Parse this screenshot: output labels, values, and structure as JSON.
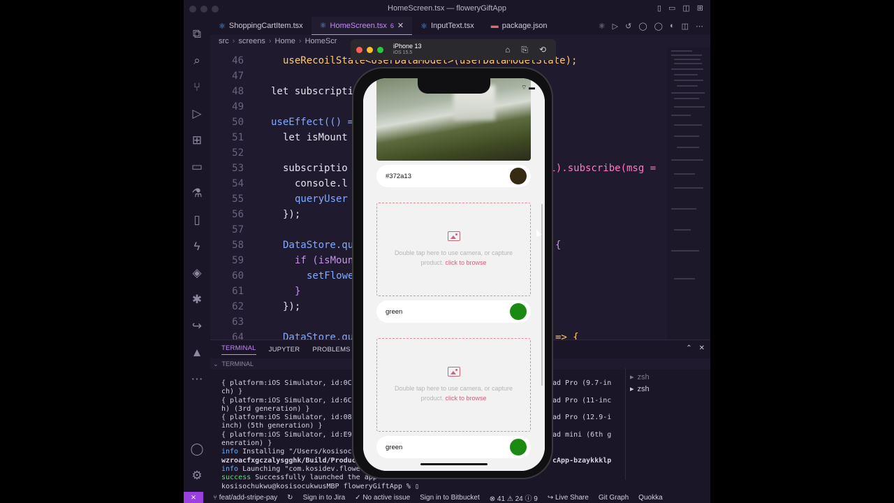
{
  "window": {
    "title": "HomeScreen.tsx — floweryGiftApp"
  },
  "tabs": [
    {
      "label": "ShoppingCartItem.tsx"
    },
    {
      "label": "HomeScreen.tsx",
      "badge": "6"
    },
    {
      "label": "InputText.tsx"
    },
    {
      "label": "package.json"
    }
  ],
  "breadcrumb": [
    "src",
    "screens",
    "Home",
    "HomeScr"
  ],
  "editor": {
    "lines": [
      {
        "n": "46",
        "code": "useRecoilState<UserDataModel>(userDataModelState);"
      },
      {
        "n": "47",
        "code": ""
      },
      {
        "n": "48",
        "code": "let subscripti"
      },
      {
        "n": "49",
        "code": ""
      },
      {
        "n": "50",
        "code": "useEffect(() ="
      },
      {
        "n": "51",
        "code": "let isMount"
      },
      {
        "n": "52",
        "code": ""
      },
      {
        "n": "53",
        "code": "subscriptio"
      },
      {
        "n": "54",
        "code": "console.l"
      },
      {
        "n": "55",
        "code": "queryUser"
      },
      {
        "n": "56",
        "code": "});"
      },
      {
        "n": "57",
        "code": ""
      },
      {
        "n": "58",
        "code": "DataStore.qu"
      },
      {
        "n": "59",
        "code": "if (isMoun"
      },
      {
        "n": "60",
        "code": "setFlowe"
      },
      {
        "n": "61",
        "code": "}"
      },
      {
        "n": "62",
        "code": "});"
      },
      {
        "n": "63",
        "code": ""
      },
      {
        "n": "64",
        "code": "DataStore.qu"
      }
    ],
    "right_fragments": {
      "l53": "el).subscribe(msg =",
      "l58": "{",
      "l64": "=> {"
    }
  },
  "panel": {
    "tabs": [
      "TERMINAL",
      "JUPYTER",
      "PROBLEMS"
    ],
    "section": "TERMINAL",
    "terminal_lines": [
      "{ platform:iOS Simulator, id:0C74",
      "ch) }",
      "{ platform:iOS Simulator, id:6C32",
      "h) (3rd generation) }",
      "{ platform:iOS Simulator, id:08AF",
      "inch) (5th generation) }",
      "{ platform:iOS Simulator, id:E9B7",
      "eneration) }"
    ],
    "terminal_right": [
      "ad Pro (9.7-in",
      "",
      "ad Pro (11-inc",
      "",
      "ad Pro (12.9-i",
      "",
      "ad mini (6th g",
      ""
    ],
    "info_install": "Installing \"/Users/kosisochuk",
    "install_path": "wzroacfxgczalysgghk/Build/Products",
    "install_right": "cApp-bzaykkklp",
    "info_launch": "Launching \"com.kosidev.flowery",
    "success_text": "Successfully launched the app",
    "prompt": "kosisochukwu@kosisocukwusMBP floweryGiftApp % ",
    "info_label": "info",
    "success_label": "success",
    "shells": [
      "zsh",
      "zsh"
    ]
  },
  "statusbar": {
    "branch": "feat/add-stripe-pay",
    "jira": "Sign in to Jira",
    "issue": "No active issue",
    "bitbucket": "Sign in to Bitbucket",
    "errors": "41",
    "warnings": "24",
    "infos": "9",
    "liveshare": "Live Share",
    "gitgraph": "Git Graph",
    "quokka": "Quokka"
  },
  "simulator": {
    "device": "iPhone 13",
    "os": "iOS 15.5"
  },
  "app": {
    "color_row_1": "#372a13",
    "color_row_2": "green",
    "color_row_3": "green",
    "drop_text": "Double tap here to use camera, or capture product.",
    "drop_link": "click to browse",
    "swatch_1": "#372a13",
    "swatch_2": "#1a8a12"
  }
}
